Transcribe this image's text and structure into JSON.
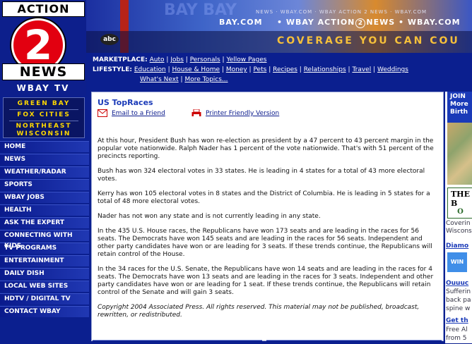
{
  "logo": {
    "top": "ACTION",
    "number": "2",
    "bottom": "NEWS",
    "call": "WBAY TV"
  },
  "region": [
    "GREEN BAY",
    "FOX CITIES",
    "NORTHEAST",
    "WISCONSIN"
  ],
  "banner": {
    "network": "abc",
    "topline": "NEWS · WBAY.COM · WBAY ACTION 2 NEWS · WBAY.COM",
    "url_left": "BAY.COM",
    "url_center": "• WBAY ACTION",
    "url_center_num": "2",
    "url_center_tail": "NEWS • WBAY.COM",
    "tagline": "COVERAGE YOU CAN COU",
    "bay": "BAY BAY"
  },
  "marketplace": {
    "label": "MARKETPLACE:",
    "links": [
      "Auto",
      "Jobs",
      "Personals",
      "Yellow Pages"
    ]
  },
  "lifestyle": {
    "label": "LIFESTYLE:",
    "links": [
      "Education",
      "House & Home",
      "Money",
      "Pets",
      "Recipes",
      "Relationships",
      "Travel",
      "Weddings"
    ],
    "links2": [
      "What's Next",
      "More Topics..."
    ]
  },
  "nav": [
    "HOME",
    "NEWS",
    "WEATHER/RADAR",
    "SPORTS",
    "WBAY JOBS",
    "HEALTH",
    "ASK THE EXPERT",
    "CONNECTING WITH KIDS",
    "TV PROGRAMS",
    "ENTERTAINMENT",
    "DAILY DISH",
    "LOCAL WEB SITES",
    "HDTV / DIGITAL TV",
    "CONTACT WBAY"
  ],
  "article": {
    "title": "US TopRaces",
    "email_label": "Email to a Friend",
    "print_label": "Printer Friendly Version",
    "paragraphs": [
      "At this hour, President Bush has won re-election as president by a 47 percent to 43 percent margin in the popular vote nationwide. Ralph Nader has 1 percent of the vote nationwide. That's with 51 percent of the precincts reporting.",
      "Bush has won 324 electoral votes in 33 states. He is leading in 4 states for a total of 43 more electoral votes.",
      "Kerry has won 105 electoral votes in 8 states and the District of Columbia. He is leading in 5 states for a total of 48 more electoral votes.",
      "Nader has not won any state and is not currently leading in any state.",
      "In the 435 U.S. House races, the Republicans have won 173 seats and are leading in the races for 56 seats. The Democrats have won 145 seats and are leading in the races for 56 seats. Independent and other party candidates have won or are leading for 3 seats. If these trends continue, the Republicans will retain control of the House.",
      "In the 34 races for the U.S. Senate, the Republicans have won 14 seats and are leading in the races for 4 seats. The Democrats have won 13 seats and are leading in the races for 3 seats. Independent and other party candidates have won or are leading for 1 seat. If these trends continue, the Republicans will retain control of the Senate and will gain 3 seats."
    ],
    "copyright": "Copyright 2004 Associated Press. All rights reserved. This material may not be published, broadcast, rewritten, or redistributed."
  },
  "right": {
    "join": [
      "JOIN",
      "More",
      "Birth"
    ],
    "ad_top": "THE B",
    "ad_bottom": "O",
    "cover": [
      "Coverin",
      "Wisconsi"
    ],
    "diamond": "Diamo",
    "win": "WIN",
    "ouu": "Ouuuc",
    "suffer": [
      "Sufferin",
      "back pa",
      "spine w"
    ],
    "getthe": "Get th",
    "free": [
      "Free Al",
      "from 5"
    ]
  },
  "colors": {
    "brand_blue": "#0b1f8f",
    "brand_red": "#e20010",
    "link": "#0a1a8c",
    "title": "#1a3ab8"
  }
}
